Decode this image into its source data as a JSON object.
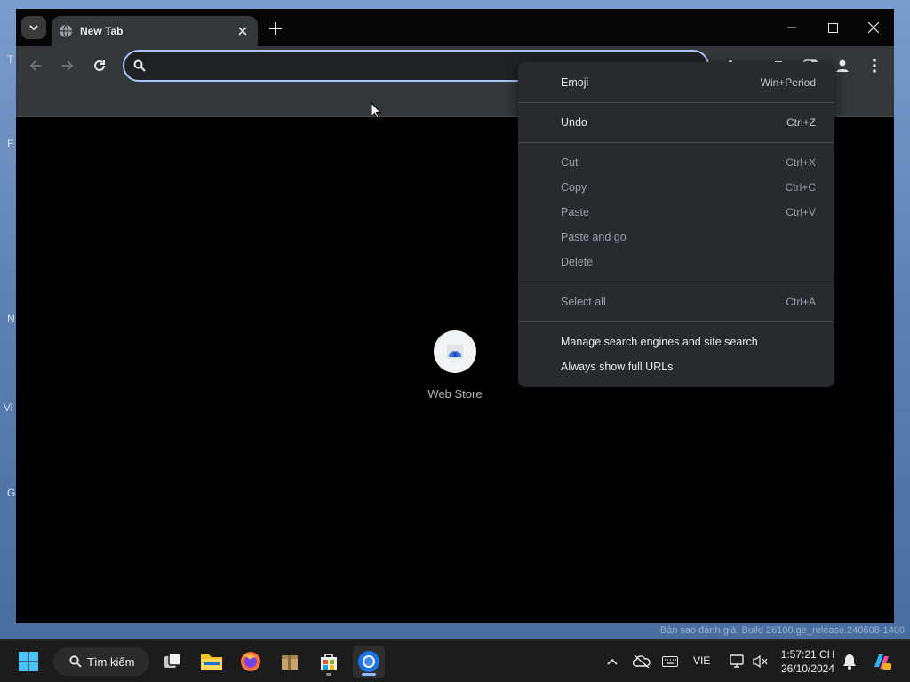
{
  "browser": {
    "tab_title": "New Tab",
    "omnibox_value": "",
    "omnibox_placeholder": ""
  },
  "new_tab_page": {
    "shortcuts": [
      {
        "label": "Web Store"
      }
    ]
  },
  "context_menu": {
    "groups": [
      [
        {
          "label": "Emoji",
          "shortcut": "Win+Period",
          "enabled": true
        }
      ],
      [
        {
          "label": "Undo",
          "shortcut": "Ctrl+Z",
          "enabled": true
        }
      ],
      [
        {
          "label": "Cut",
          "shortcut": "Ctrl+X",
          "enabled": false
        },
        {
          "label": "Copy",
          "shortcut": "Ctrl+C",
          "enabled": false
        },
        {
          "label": "Paste",
          "shortcut": "Ctrl+V",
          "enabled": false
        },
        {
          "label": "Paste and go",
          "shortcut": "",
          "enabled": false
        },
        {
          "label": "Delete",
          "shortcut": "",
          "enabled": false
        }
      ],
      [
        {
          "label": "Select all",
          "shortcut": "Ctrl+A",
          "enabled": false
        }
      ],
      [
        {
          "label": "Manage search engines and site search",
          "shortcut": "",
          "enabled": true
        },
        {
          "label": "Always show full URLs",
          "shortcut": "",
          "enabled": true
        }
      ]
    ]
  },
  "taskbar": {
    "search_label": "Tìm kiếm",
    "language": "VIE",
    "time": "1:57:21 CH",
    "date": "26/10/2024",
    "apps": [
      {
        "name": "start-button",
        "icon": "windows-logo-icon"
      },
      {
        "name": "task-view-button",
        "icon": "task-view-icon"
      },
      {
        "name": "file-explorer",
        "icon": "folder-icon"
      },
      {
        "name": "firefox",
        "icon": "firefox-icon"
      },
      {
        "name": "archive-app",
        "icon": "package-icon"
      },
      {
        "name": "microsoft-store",
        "icon": "store-icon"
      },
      {
        "name": "chromium",
        "icon": "chromium-icon",
        "active": true
      }
    ]
  },
  "desktop": {
    "build_watermark": "Bản sao đánh giá. Build 26100.ge_release.240608-1400"
  },
  "colors": {
    "omnibox_focus": "#a8c7fa",
    "menu_bg": "#292a2d",
    "toolbar_bg": "#35363a",
    "taskbar_bg": "#1c1c1c"
  }
}
